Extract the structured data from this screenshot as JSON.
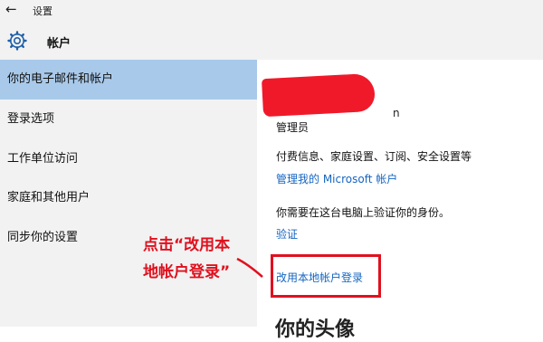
{
  "titlebar": {
    "back_icon": "←",
    "title": "设置"
  },
  "header": {
    "icon": "gear-icon",
    "title": "帐户"
  },
  "sidebar": {
    "items": [
      {
        "label": "你的电子邮件和帐户",
        "selected": true
      },
      {
        "label": "登录选项"
      },
      {
        "label": "工作单位访问"
      },
      {
        "label": "家庭和其他用户"
      },
      {
        "label": "同步你的设置"
      }
    ]
  },
  "content": {
    "obscured_tail": "n",
    "role": "管理员",
    "billing_text": "付费信息、家庭设置、订阅、安全设置等",
    "manage_link": "管理我的 Microsoft 帐户",
    "verify_text": "你需要在这台电脑上验证你的身份。",
    "verify_link": "验证",
    "local_login_link": "改用本地帐户登录",
    "next_heading_partial": "你的头像"
  },
  "annotation": {
    "line1": "点击“改用本",
    "line2": "地帐户登录”",
    "color": "#e0101e"
  },
  "colors": {
    "accent": "#1565c0",
    "selected": "#a9c9ea",
    "sidebar_bg": "#f2f2f2",
    "redaction": "#f0192a"
  }
}
